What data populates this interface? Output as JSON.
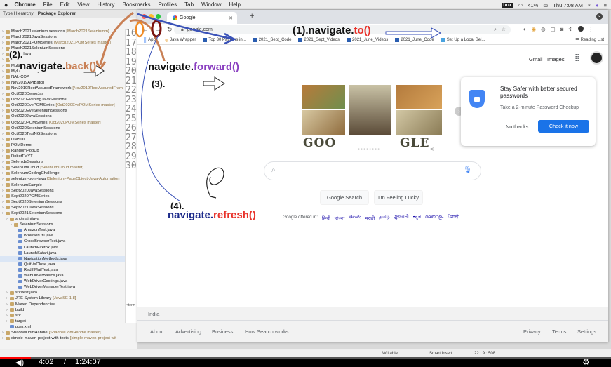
{
  "menubar": {
    "app": "Chrome",
    "items": [
      "File",
      "Edit",
      "View",
      "History",
      "Bookmarks",
      "Profiles",
      "Tab",
      "Window",
      "Help"
    ],
    "box_label": "box",
    "battery": "41%",
    "clock": "Thu 7:08 AM"
  },
  "eclipse": {
    "tabs": [
      "Type Hierarchy",
      "Package Explorer"
    ],
    "tree": [
      {
        "label": "March2021selenium sessions",
        "suffix": "[March2021Seleniumm]",
        "type": "proj"
      },
      {
        "label": "March2021JavaSessions",
        "suffix": "",
        "type": "proj"
      },
      {
        "label": "March2021POMSeries",
        "suffix": "[March2021POMSeries master]",
        "type": "proj"
      },
      {
        "label": "March2021SeleniumSessions",
        "suffix": "",
        "type": "proj"
      },
      {
        "label": "Mavenlava",
        "suffix": "",
        "type": "proj"
      },
      {
        "label": "Maven",
        "suffix": "",
        "type": "proj"
      },
      {
        "label": "MultiThreading",
        "suffix": "",
        "type": "proj"
      },
      {
        "label": "MyLambdaProject",
        "suffix": "",
        "type": "proj"
      },
      {
        "label": "NAL-COP",
        "suffix": "",
        "type": "proj"
      },
      {
        "label": "Nov2019APIBatch",
        "suffix": "",
        "type": "proj"
      },
      {
        "label": "Nov2019RestAssuredFramework",
        "suffix": "[Nov2019RestAssuredFram",
        "type": "proj"
      },
      {
        "label": "Oct2020DemoJar",
        "suffix": "",
        "type": "proj"
      },
      {
        "label": "Oct2020EveningJavaSessions",
        "suffix": "",
        "type": "proj"
      },
      {
        "label": "Oct2020EvePOMSeries",
        "suffix": "[Oct2020EvePOMSeries master]",
        "type": "proj"
      },
      {
        "label": "Oct2020EveSeleniumSessions",
        "suffix": "",
        "type": "proj"
      },
      {
        "label": "Oct2020JavaSessions",
        "suffix": "",
        "type": "proj"
      },
      {
        "label": "Oct2020POMSeries",
        "suffix": "[Oct2020POMSeries master]",
        "type": "proj"
      },
      {
        "label": "Oct2020SeleniumSessions",
        "suffix": "",
        "type": "proj"
      },
      {
        "label": "Oct2020TestNGSessions",
        "suffix": "",
        "type": "proj"
      },
      {
        "label": "OMSUI",
        "suffix": "",
        "type": "proj"
      },
      {
        "label": "POMDemo",
        "suffix": "",
        "type": "proj"
      },
      {
        "label": "RandomPopUp",
        "suffix": "",
        "type": "proj"
      },
      {
        "label": "RobotFwYT",
        "suffix": "",
        "type": "proj"
      },
      {
        "label": "SelenideSessions",
        "suffix": "",
        "type": "proj"
      },
      {
        "label": "SeleniumCloud",
        "suffix": "[SeleniumCloud master]",
        "type": "proj"
      },
      {
        "label": "SeleniumCodingChallenge",
        "suffix": "",
        "type": "proj"
      },
      {
        "label": "selenium-pom-java",
        "suffix": "[Selenium-PageObject-Java-Automation",
        "type": "proj"
      },
      {
        "label": "SeleniumSample",
        "suffix": "",
        "type": "proj"
      },
      {
        "label": "Sept2020JavaSessions",
        "suffix": "",
        "type": "proj"
      },
      {
        "label": "Sept2020POMSeries",
        "suffix": "",
        "type": "proj"
      },
      {
        "label": "Sept2020SeleniumSessions",
        "suffix": "",
        "type": "proj"
      },
      {
        "label": "Sept2021JavaSessions",
        "suffix": "",
        "type": "proj"
      },
      {
        "label": "Sept2021SeleniumSessions",
        "suffix": "",
        "type": "proj"
      },
      {
        "label": "src/main/java",
        "suffix": "",
        "type": "pkg",
        "indent": 1
      },
      {
        "label": "SeleniumSessions",
        "suffix": "",
        "type": "pkg",
        "indent": 2
      },
      {
        "label": "AmazonTest.java",
        "suffix": "",
        "type": "java",
        "indent": 3
      },
      {
        "label": "BrowserUtil.java",
        "suffix": "",
        "type": "java",
        "indent": 3
      },
      {
        "label": "CrossBrowserTest.java",
        "suffix": "",
        "type": "java",
        "indent": 3
      },
      {
        "label": "LaunchFirefox.java",
        "suffix": "",
        "type": "java",
        "indent": 3
      },
      {
        "label": "LaunchSafari.java",
        "suffix": "",
        "type": "java",
        "indent": 3
      },
      {
        "label": "NavigationMethods.java",
        "suffix": "",
        "type": "java",
        "indent": 3,
        "selected": true
      },
      {
        "label": "QuitVsClose.java",
        "suffix": "",
        "type": "java",
        "indent": 3
      },
      {
        "label": "RediffMailTest.java",
        "suffix": "",
        "type": "java",
        "indent": 3
      },
      {
        "label": "WebDriverBasics.java",
        "suffix": "",
        "type": "java",
        "indent": 3
      },
      {
        "label": "WebDriverCastings.java",
        "suffix": "",
        "type": "java",
        "indent": 3
      },
      {
        "label": "WebDriverManagerTest.java",
        "suffix": "",
        "type": "java",
        "indent": 3
      },
      {
        "label": "src/test/java",
        "suffix": "",
        "type": "pkg",
        "indent": 1
      },
      {
        "label": "JRE System Library",
        "suffix": "[JavaSE-1.8]",
        "type": "lib",
        "indent": 1
      },
      {
        "label": "Maven Dependencies",
        "suffix": "",
        "type": "lib",
        "indent": 1
      },
      {
        "label": "build",
        "suffix": "",
        "type": "pkg",
        "indent": 1
      },
      {
        "label": "src",
        "suffix": "",
        "type": "pkg",
        "indent": 1
      },
      {
        "label": "target",
        "suffix": "",
        "type": "pkg",
        "indent": 1
      },
      {
        "label": "pom.xml",
        "suffix": "",
        "type": "java",
        "indent": 1
      },
      {
        "label": "ShadowDomHandle",
        "suffix": "[ShadowDomHandle master]",
        "type": "proj"
      },
      {
        "label": "simple-maven-project-with-tests",
        "suffix": "[simple-maven-project-wit",
        "type": "proj"
      }
    ],
    "line_numbers": [
      "16",
      "17",
      "18",
      "19",
      "20",
      "21",
      "22",
      "23",
      "24",
      "25",
      "26",
      "27",
      "28",
      "29",
      "30"
    ],
    "code_tab_label": "<term"
  },
  "browser": {
    "tab_title": "Google",
    "url": "google.com",
    "bookmarks": [
      "Apps",
      "Java Wrapper",
      "Top 30 Patterns in...",
      "2021_Sept_Code",
      "2021_Sept_Videos",
      "2021_June_Videos",
      "2021_June_Code",
      "Set Up a Local Sel..."
    ],
    "reading_list": "Reading List",
    "header_links": [
      "Gmail",
      "Images"
    ],
    "logo_letters": [
      "G",
      "O",
      "O",
      "G",
      "L",
      "E"
    ],
    "popup": {
      "title": "Stay Safer with better secured passwords",
      "body": "Take a 2-minute Password Checkup",
      "no_thanks": "No thanks",
      "check_now": "Check it now"
    },
    "buttons": {
      "search": "Google Search",
      "lucky": "I'm Feeling Lucky"
    },
    "offered_in": "Google offered in:",
    "languages": [
      "हिन्दी",
      "বাংলা",
      "తెలుగు",
      "मराठी",
      "தமிழ்",
      "ગુજરાતી",
      "ಕನ್ನಡ",
      "മലയാളം",
      "ਪੰਜਾਬੀ"
    ],
    "footer": {
      "country": "India",
      "left": [
        "About",
        "Advertising",
        "Business",
        "How Search works"
      ],
      "right": [
        "Privacy",
        "Terms",
        "Settings"
      ]
    }
  },
  "annotations": {
    "to": {
      "num": "(1).",
      "method": "navigate.",
      "fn": "to()"
    },
    "back": {
      "num": "(2).",
      "method": "navigate.",
      "fn": "back()"
    },
    "forward": {
      "num": "(3).",
      "method": "navigate.",
      "fn": "forward()"
    },
    "refresh": {
      "num": "(4).",
      "method": "navigate.",
      "fn": "refresh()"
    }
  },
  "statusbar": {
    "mode": "Writable",
    "insert": "Smart Insert",
    "pos": "22 : 9 : 508"
  },
  "video": {
    "current": "4:02",
    "total": "1:24:07",
    "separator": "/"
  },
  "colors": {
    "accent_blue": "#1a73e8",
    "annotation_red": "#e8322a",
    "annotation_purple": "#8a3fc0",
    "annotation_brown": "#c98055",
    "annotation_navy": "#1c2a8a"
  }
}
